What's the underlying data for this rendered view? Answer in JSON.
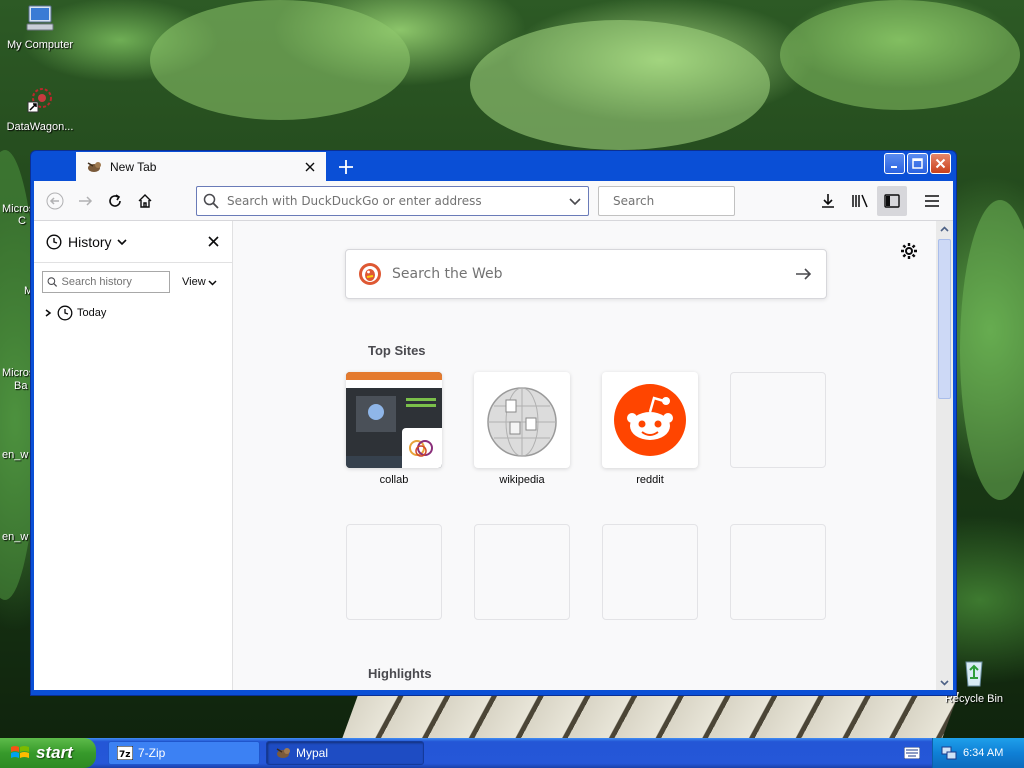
{
  "desktop": {
    "icons": [
      {
        "label": "My Computer"
      },
      {
        "label": "DataWagon..."
      },
      {
        "label": "Recycle Bin"
      }
    ],
    "partial_labels": [
      "Micros",
      "C",
      "M",
      "Micros",
      "Ba",
      "en_w",
      "en_w"
    ]
  },
  "browser": {
    "tab": {
      "title": "New Tab"
    },
    "urlbar": {
      "placeholder": "Search with DuckDuckGo or enter address"
    },
    "searchbar": {
      "placeholder": "Search"
    },
    "sidebar": {
      "title": "History",
      "search_placeholder": "Search history",
      "view_label": "View",
      "tree": [
        {
          "label": "Today"
        }
      ]
    },
    "newtab": {
      "search_placeholder": "Search the Web",
      "top_sites_title": "Top Sites",
      "highlights_title": "Highlights",
      "top_sites": [
        {
          "label": "collab"
        },
        {
          "label": "wikipedia"
        },
        {
          "label": "reddit"
        }
      ]
    }
  },
  "taskbar": {
    "start_label": "start",
    "tasks": [
      {
        "label": "7-Zip"
      },
      {
        "label": "Mypal"
      }
    ],
    "clock": "6:34 AM"
  },
  "colors": {
    "xp_blue": "#0a4fd6",
    "reddit_orange": "#ff4500",
    "duckduckgo_orange": "#de5833",
    "start_green": "#379a2b"
  }
}
